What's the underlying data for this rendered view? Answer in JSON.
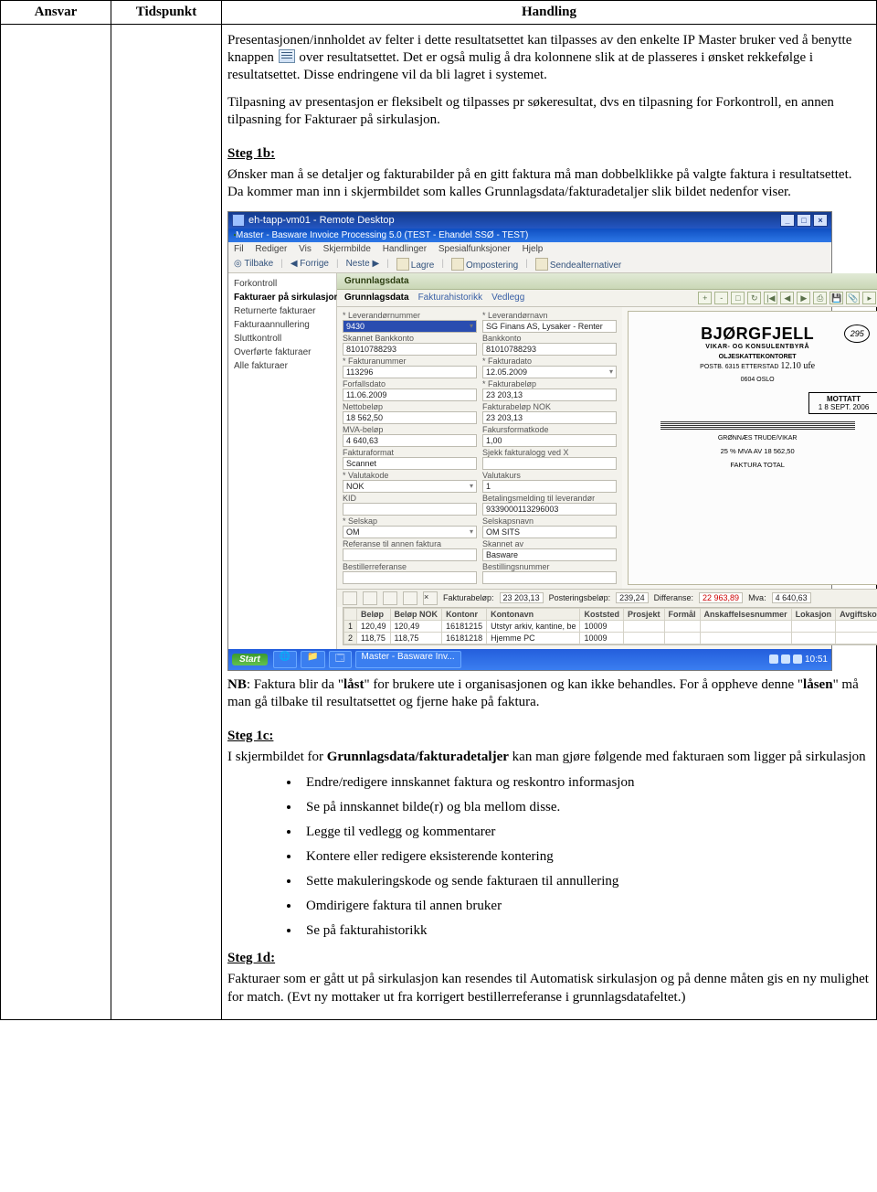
{
  "table_headers": {
    "c1": "Ansvar",
    "c2": "Tidspunkt",
    "c3": "Handling"
  },
  "para_intro_a": "Presentasjonen/innholdet av felter i dette resultatsettet kan tilpasses av den enkelte IP Master bruker ved å benytte knappen",
  "para_intro_b": " over resultatsettet. Det er også mulig å dra kolonnene slik at de plasseres i ønsket rekkefølge i resultatsettet. Disse endringene vil da bli lagret i systemet.",
  "para_intro2": "Tilpasning av presentasjon er fleksibelt og tilpasses pr søkeresultat, dvs en tilpasning for Forkontroll, en annen tilpasning for Fakturaer på sirkulasjon.",
  "step1b_head": "Steg 1b:",
  "step1b_text": "Ønsker man å se detaljer og fakturabilder på en gitt faktura må man dobbelklikke på valgte faktura i resultatsettet. Da kommer man inn i skjermbildet som kalles Grunnlagsdata/fakturadetaljer slik bildet nedenfor viser.",
  "nb_prefix": "NB",
  "nb_rest_a": ": Faktura blir da \"",
  "nb_lock": "låst",
  "nb_rest_b": "\" for brukere ute i organisasjonen og kan ikke behandles. For å oppheve denne \"",
  "nb_lock2": "låsen",
  "nb_rest_c": "\" må man gå tilbake til resultatsettet og fjerne hake på faktura.",
  "step1c_head": "Steg 1c:",
  "step1c_text_a": "I skjermbildet for ",
  "step1c_bold": "Grunnlagsdata/fakturadetaljer",
  "step1c_text_b": " kan man gjøre følgende med fakturaen som ligger på sirkulasjon",
  "bullets": [
    "Endre/redigere innskannet faktura og reskontro informasjon",
    "Se på innskannet bilde(r) og bla mellom disse.",
    "Legge til vedlegg og kommentarer",
    "Kontere eller redigere eksisterende kontering",
    "Sette makuleringskode og sende fakturaen til annullering",
    "Omdirigere faktura til annen bruker",
    "Se på fakturahistorikk"
  ],
  "step1d_head": "Steg 1d:",
  "step1d_text": "Fakturaer som er gått ut på sirkulasjon kan resendes til Automatisk sirkulasjon og på denne måten gis en ny mulighet for match. (Evt ny mottaker ut fra korrigert bestillerreferanse i grunnlagsdatafeltet.)",
  "ss": {
    "titlebar": "eh-tapp-vm01 - Remote Desktop",
    "subtitle": "Master - Basware Invoice Processing 5.0 (TEST - Ehandel SSØ - TEST)",
    "menu": [
      "Fil",
      "Rediger",
      "Vis",
      "Skjermbilde",
      "Handlinger",
      "Spesialfunksjoner",
      "Hjelp"
    ],
    "toolbar": {
      "back": "Tilbake",
      "prev": "Forrige",
      "next": "Neste",
      "save": "Lagre",
      "ompost": "Ompostering",
      "send": "Sendealternativer"
    },
    "sidebar": [
      "Forkontroll",
      "Fakturaer på sirkulasjon",
      "Returnerte fakturaer",
      "Fakturaannullering",
      "Sluttkontroll",
      "Overførte fakturaer",
      "Alle fakturaer"
    ],
    "sectionhead": "Grunnlagsdata",
    "tabs": [
      "Grunnlagsdata",
      "Fakturahistorikk",
      "Vedlegg"
    ],
    "fields_left": [
      {
        "label": "* Leverandørnummer",
        "val": "9430",
        "kind": "selblue"
      },
      {
        "label": "Skannet Bankkonto",
        "val": "81010788293"
      },
      {
        "label": "* Fakturanummer",
        "val": "113296"
      },
      {
        "label": "Forfallsdato",
        "val": "11.06.2009"
      },
      {
        "label": "Nettobeløp",
        "val": "18 562,50"
      },
      {
        "label": "MVA-beløp",
        "val": "4 640,63"
      },
      {
        "label": "Fakturaformat",
        "val": "Scannet"
      },
      {
        "label": "* Valutakode",
        "val": "NOK",
        "kind": "sel"
      },
      {
        "label": "KID",
        "val": ""
      },
      {
        "label": "* Selskap",
        "val": "OM",
        "kind": "sel"
      },
      {
        "label": "Referanse til annen faktura",
        "val": ""
      },
      {
        "label": "Bestillerreferanse",
        "val": ""
      }
    ],
    "fields_right": [
      {
        "label": "* Leverandørnavn",
        "val": "SG Finans AS, Lysaker - Renter"
      },
      {
        "label": "Bankkonto",
        "val": "81010788293"
      },
      {
        "label": "* Fakturadato",
        "val": "12.05.2009",
        "kind": "sel"
      },
      {
        "label": "* Fakturabeløp",
        "val": "23 203,13"
      },
      {
        "label": "Fakturabeløp NOK",
        "val": "23 203,13"
      },
      {
        "label": "Fakursformatkode",
        "val": "1,00"
      },
      {
        "label": "Sjekk fakturalogg ved X",
        "val": ""
      },
      {
        "label": "Valutakurs",
        "val": "1"
      },
      {
        "label": "Betalingsmelding til leverandør",
        "val": "9339000113296003"
      },
      {
        "label": "Selskapsnavn",
        "val": "OM SITS"
      },
      {
        "label": "Skannet av",
        "val": "Basware"
      },
      {
        "label": "Bestillingsnummer",
        "val": ""
      }
    ],
    "preview": {
      "brand": "BJØRGFJELL",
      "tag": "VIKAR- OG KONSULENTBYRÅ",
      "addr1": "OLJESKATTEKONTORET",
      "addr2": "POSTB. 6315 ETTERSTAD",
      "city": "0604 OSLO",
      "circle": "295",
      "hand": "12.10 ufe",
      "stamp1": "MOTTATT",
      "stamp2": "1 8 SEPT. 2006",
      "stamp3": "OLJESKATTEKONTORET",
      "box2": "GRØNNÆS TRUDE/VIKAR",
      "mva": "25 % MVA AV 18 562,50",
      "ft": "FAKTURA TOTAL"
    },
    "status": {
      "fb_label": "Fakturabeløp:",
      "fb": "23 203,13",
      "pb_label": "Posteringsbeløp:",
      "pb": "239,24",
      "df_label": "Differanse:",
      "df": "22 963,89",
      "mv_label": "Mva:",
      "mv": "4 640,63"
    },
    "grid": {
      "headers": [
        "",
        "Beløp",
        "Beløp NOK",
        "Kontonr",
        "Kontonavn",
        "Koststed",
        "Prosjekt",
        "Formål",
        "Anskaffelsesnummer",
        "Lokasjon",
        "Avgiftskod"
      ],
      "rows": [
        [
          "1",
          "120,49",
          "120,49",
          "16181215",
          "Utstyr arkiv, kantine, be",
          "10009",
          "",
          "",
          "",
          "",
          ""
        ],
        [
          "2",
          "118,75",
          "118,75",
          "16181218",
          "Hjemme PC",
          "10009",
          "",
          "",
          "",
          "",
          ""
        ]
      ]
    },
    "taskbar": {
      "start": "Start",
      "task": "Master - Basware Inv...",
      "clock": "10:51"
    }
  }
}
